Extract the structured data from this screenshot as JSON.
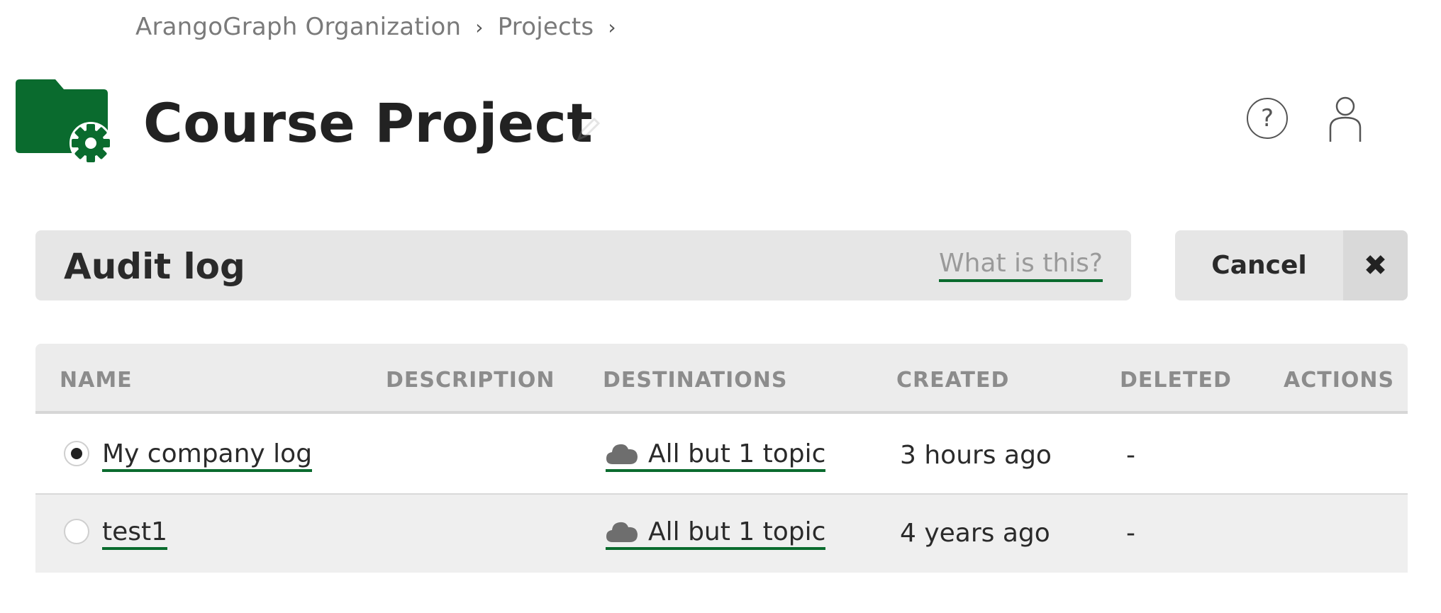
{
  "breadcrumb": {
    "items": [
      "ArangoGraph Organization",
      "Projects"
    ],
    "separator": "›"
  },
  "header": {
    "title": "Course Project",
    "help_symbol": "?",
    "icon_color": "#0a6b2e"
  },
  "panel": {
    "title": "Audit log",
    "help_link": "What is this?",
    "cancel_label": "Cancel",
    "close_symbol": "✖"
  },
  "table": {
    "columns": [
      "NAME",
      "DESCRIPTION",
      "DESTINATIONS",
      "CREATED",
      "DELETED",
      "ACTIONS"
    ],
    "rows": [
      {
        "selected": true,
        "name": "My company log",
        "description": "",
        "destinations": "All but 1 topic",
        "created": "3 hours ago",
        "deleted": "-"
      },
      {
        "selected": false,
        "name": "test1",
        "description": "",
        "destinations": "All but 1 topic",
        "created": "4 years ago",
        "deleted": "-"
      }
    ]
  },
  "colors": {
    "accent": "#0a6b2e",
    "bar_bg": "#e6e6e6",
    "header_text": "#8c8c8c"
  }
}
